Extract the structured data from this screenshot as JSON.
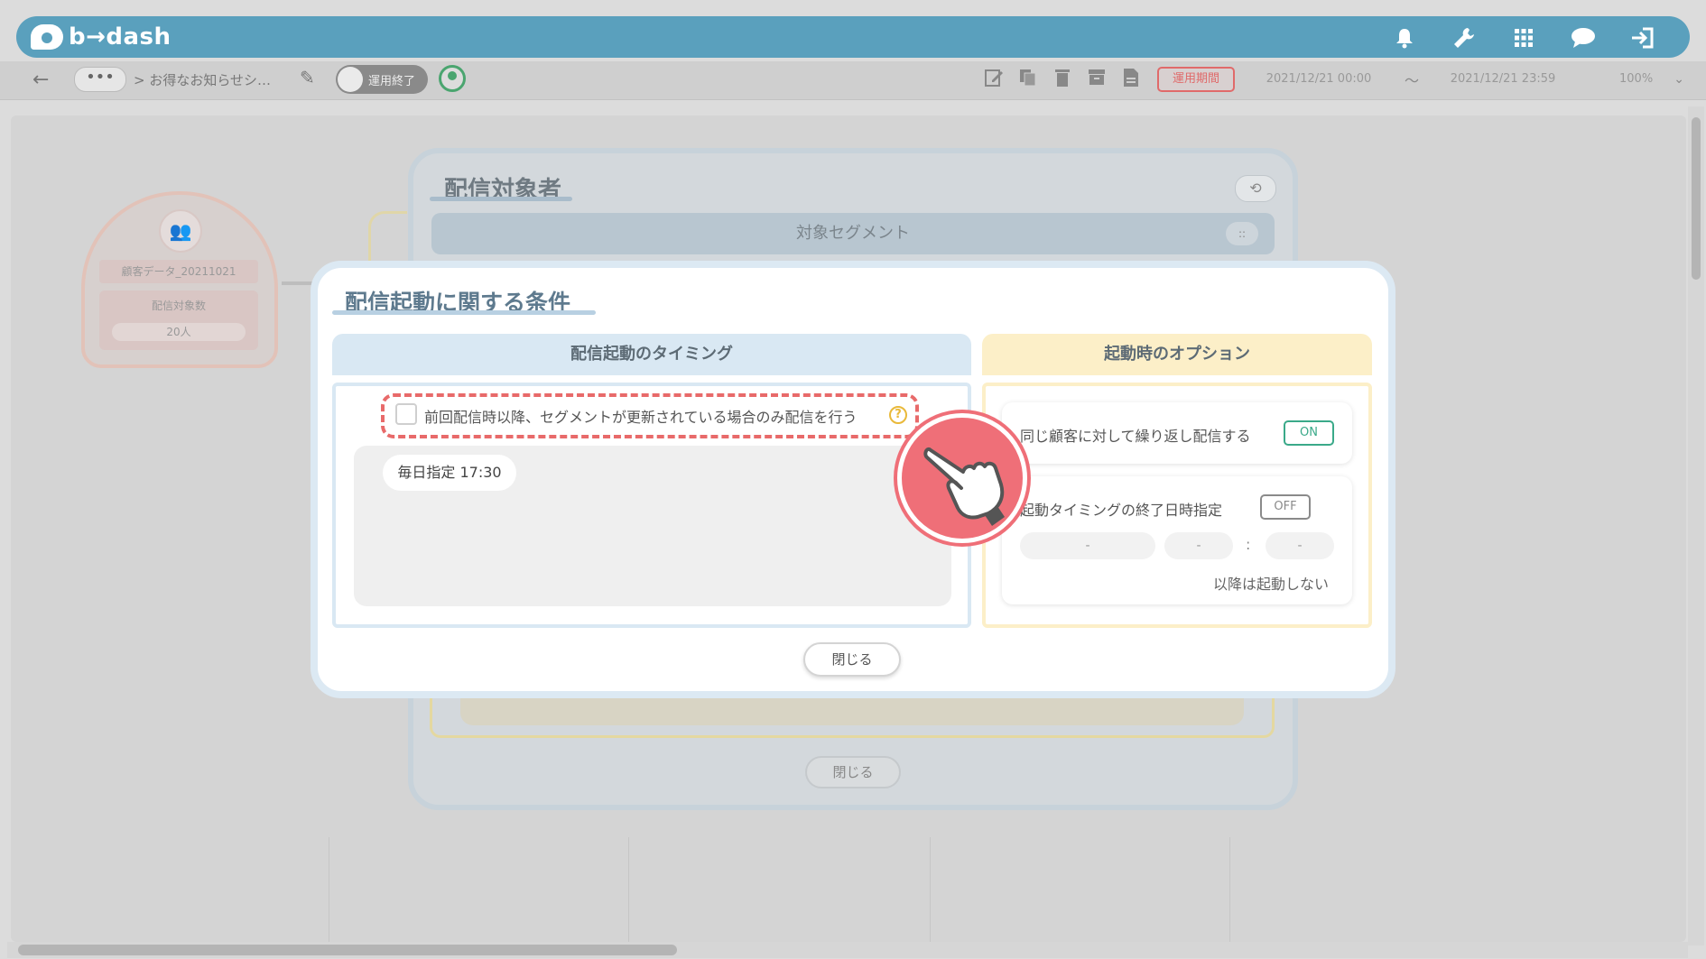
{
  "app": {
    "logo_text": "b→dash"
  },
  "header": {
    "icons": [
      "bell-icon",
      "wrench-icon",
      "grid-icon",
      "chat-icon",
      "logout-icon"
    ]
  },
  "toolbar": {
    "back_icon": "←",
    "breadcrumb_dots": "•••",
    "breadcrumb": "> お得なお知らせシ…",
    "edit_icon": "✎",
    "status_toggle_label": "運用終了",
    "period_button": "運用期間",
    "start_datetime": "2021/12/21 00:00",
    "date_separator": "～",
    "end_datetime": "2021/12/21 23:59",
    "zoom": "100%",
    "zoom_chevron": "⌄"
  },
  "canvas_node": {
    "icon": "👥",
    "name": "顧客データ_20211021",
    "count_label": "配信対象数",
    "count_value": "20人"
  },
  "background_dialog": {
    "title": "配信対象者",
    "history_icon": "⟲",
    "segment_header": "対象セグメント",
    "segment_icon": "::",
    "close_label": "閉じる"
  },
  "dialog": {
    "title": "配信起動に関する条件",
    "timing_header": "配信起動のタイミング",
    "options_header": "起動時のオプション",
    "only_updated_checkbox_label": "前回配信時以降、セグメントが更新されている場合のみ配信を行う",
    "help_icon": "?",
    "timing_value": "毎日指定 17:30",
    "repeat_label": "同じ顧客に対して繰り返し配信する",
    "repeat_toggle": "ON",
    "end_datetime_label": "起動タイミングの終了日時指定",
    "end_datetime_toggle": "OFF",
    "end_date_placeholder": "-",
    "end_hour_placeholder": "-",
    "time_colon": ":",
    "end_minute_placeholder": "-",
    "after_note": "以降は起動しない",
    "close_label": "閉じる"
  },
  "colors": {
    "header_bar": "#5aa0bd",
    "highlight_dash": "#e86a6a",
    "pointer_badge": "#ef6f78",
    "toggle_on": "#3aa989",
    "timing_header_bg": "#d9e8f3",
    "options_header_bg": "#fcefc8"
  }
}
